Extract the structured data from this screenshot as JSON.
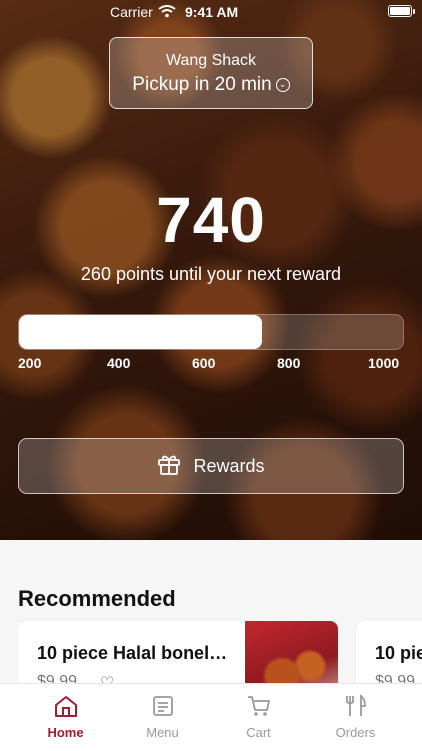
{
  "status_bar": {
    "carrier": "Carrier",
    "time": "9:41 AM"
  },
  "store": {
    "name": "Wang Shack",
    "pickup": "Pickup in 20 min"
  },
  "rewards": {
    "points": "740",
    "subtitle": "260 points until your next reward",
    "progress_fraction": 0.634,
    "ticks": [
      "200",
      "400",
      "600",
      "800",
      "1000"
    ],
    "button_label": "Rewards"
  },
  "recommended": {
    "title": "Recommended",
    "items": [
      {
        "title": "10 piece Halal bonel…",
        "price": "$9.99"
      },
      {
        "title": "10 pie",
        "price": "$9.99"
      }
    ]
  },
  "tabs": [
    {
      "label": "Home",
      "icon": "home-icon",
      "active": true
    },
    {
      "label": "Menu",
      "icon": "menu-icon",
      "active": false
    },
    {
      "label": "Cart",
      "icon": "cart-icon",
      "active": false
    },
    {
      "label": "Orders",
      "icon": "orders-icon",
      "active": false
    }
  ],
  "colors": {
    "accent": "#a51d2d",
    "inactive": "#9a9a9a"
  }
}
